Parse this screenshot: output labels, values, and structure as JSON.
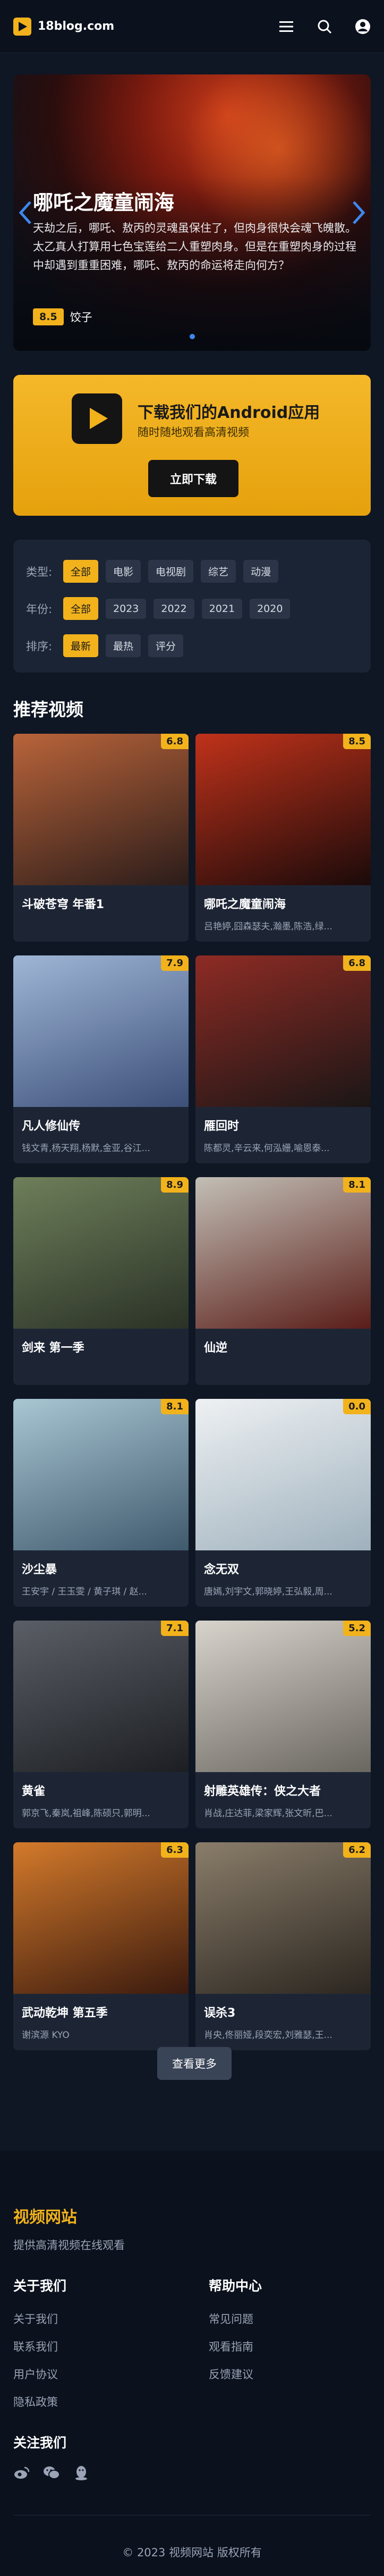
{
  "header": {
    "logo_text": "18blog.com"
  },
  "hero": {
    "title": "哪吒之魔童闹海",
    "description": "天劫之后，哪吒、敖丙的灵魂虽保住了，但肉身很快会魂飞魄散。太乙真人打算用七色宝莲给二人重塑肉身。但是在重塑肉身的过程中却遇到重重困难，哪吒、敖丙的命运将走向何方？",
    "score": "8.5",
    "tag": "饺子"
  },
  "app": {
    "title": "下载我们的Android应用",
    "subtitle": "随时随地观看高清视频",
    "button": "立即下载"
  },
  "filters": {
    "type": {
      "label": "类型:",
      "options": [
        "全部",
        "电影",
        "电视剧",
        "综艺",
        "动漫"
      ]
    },
    "year": {
      "label": "年份:",
      "options": [
        "全部",
        "2023",
        "2022",
        "2021",
        "2020"
      ]
    },
    "sort": {
      "label": "排序:",
      "options": [
        "最新",
        "最热",
        "评分"
      ]
    }
  },
  "section": {
    "title": "推荐视频"
  },
  "cards": [
    {
      "title": "斗破苍穹 年番1",
      "actors": "",
      "rating": "6.8",
      "c1": "#b9643a",
      "c2": "#2b1c1a"
    },
    {
      "title": "哪吒之魔童闹海",
      "actors": "吕艳婷,囧森瑟夫,瀚墨,陈浩,绿...",
      "rating": "8.5",
      "c1": "#c0321a",
      "c2": "#1a0a0a"
    },
    {
      "title": "凡人修仙传",
      "actors": "钱文青,杨天翔,杨默,金亚,谷江...",
      "rating": "7.9",
      "c1": "#9fb6d6",
      "c2": "#3c4f78"
    },
    {
      "title": "雁回时",
      "actors": "陈都灵,辛云来,何泓姗,喻恩泰...",
      "rating": "6.8",
      "c1": "#8e2b24",
      "c2": "#1a1616"
    },
    {
      "title": "剑来 第一季",
      "actors": "",
      "rating": "8.9",
      "c1": "#6e7f5a",
      "c2": "#2a3126"
    },
    {
      "title": "仙逆",
      "actors": "",
      "rating": "8.1",
      "c1": "#c2bfb6",
      "c2": "#5a1d18"
    },
    {
      "title": "沙尘暴",
      "actors": "王安宇 / 王玉雯 / 黄子琪 / 赵...",
      "rating": "8.1",
      "c1": "#a9c6d3",
      "c2": "#3f5a6d"
    },
    {
      "title": "念无双",
      "actors": "唐嫣,刘宇文,郭晓婷,王弘毅,周...",
      "rating": "0.0",
      "c1": "#eef1f3",
      "c2": "#9fb1bd"
    },
    {
      "title": "黄雀",
      "actors": "郭京飞,秦岚,祖峰,陈硕只,郭明...",
      "rating": "7.1",
      "c1": "#5a5e66",
      "c2": "#1c1e22"
    },
    {
      "title": "射雕英雄传：侠之大者",
      "actors": "肖战,庄达菲,梁家辉,张文昕,巴...",
      "rating": "5.2",
      "c1": "#d7d4cc",
      "c2": "#6a6660"
    },
    {
      "title": "武动乾坤 第五季",
      "actors": "谢滨源 KYO",
      "rating": "6.3",
      "c1": "#d47a2b",
      "c2": "#3a1a0e"
    },
    {
      "title": "误杀3",
      "actors": "肖央,佟丽娅,段奕宏,刘雅瑟,王...",
      "rating": "6.2",
      "c1": "#8a7d6a",
      "c2": "#2b2620"
    }
  ],
  "more_button": "查看更多",
  "footer": {
    "brand": "视频网站",
    "description": "提供高清视频在线观看",
    "about": {
      "title": "关于我们",
      "links": [
        "关于我们",
        "联系我们",
        "用户协议",
        "隐私政策"
      ]
    },
    "help": {
      "title": "帮助中心",
      "links": [
        "常见问题",
        "观看指南",
        "反馈建议"
      ]
    },
    "follow_title": "关注我们",
    "copyright": "© 2023 视频网站 版权所有"
  },
  "colors": {
    "accent": "#f2b21c",
    "background": "#0f1624",
    "card": "#1d2535"
  }
}
